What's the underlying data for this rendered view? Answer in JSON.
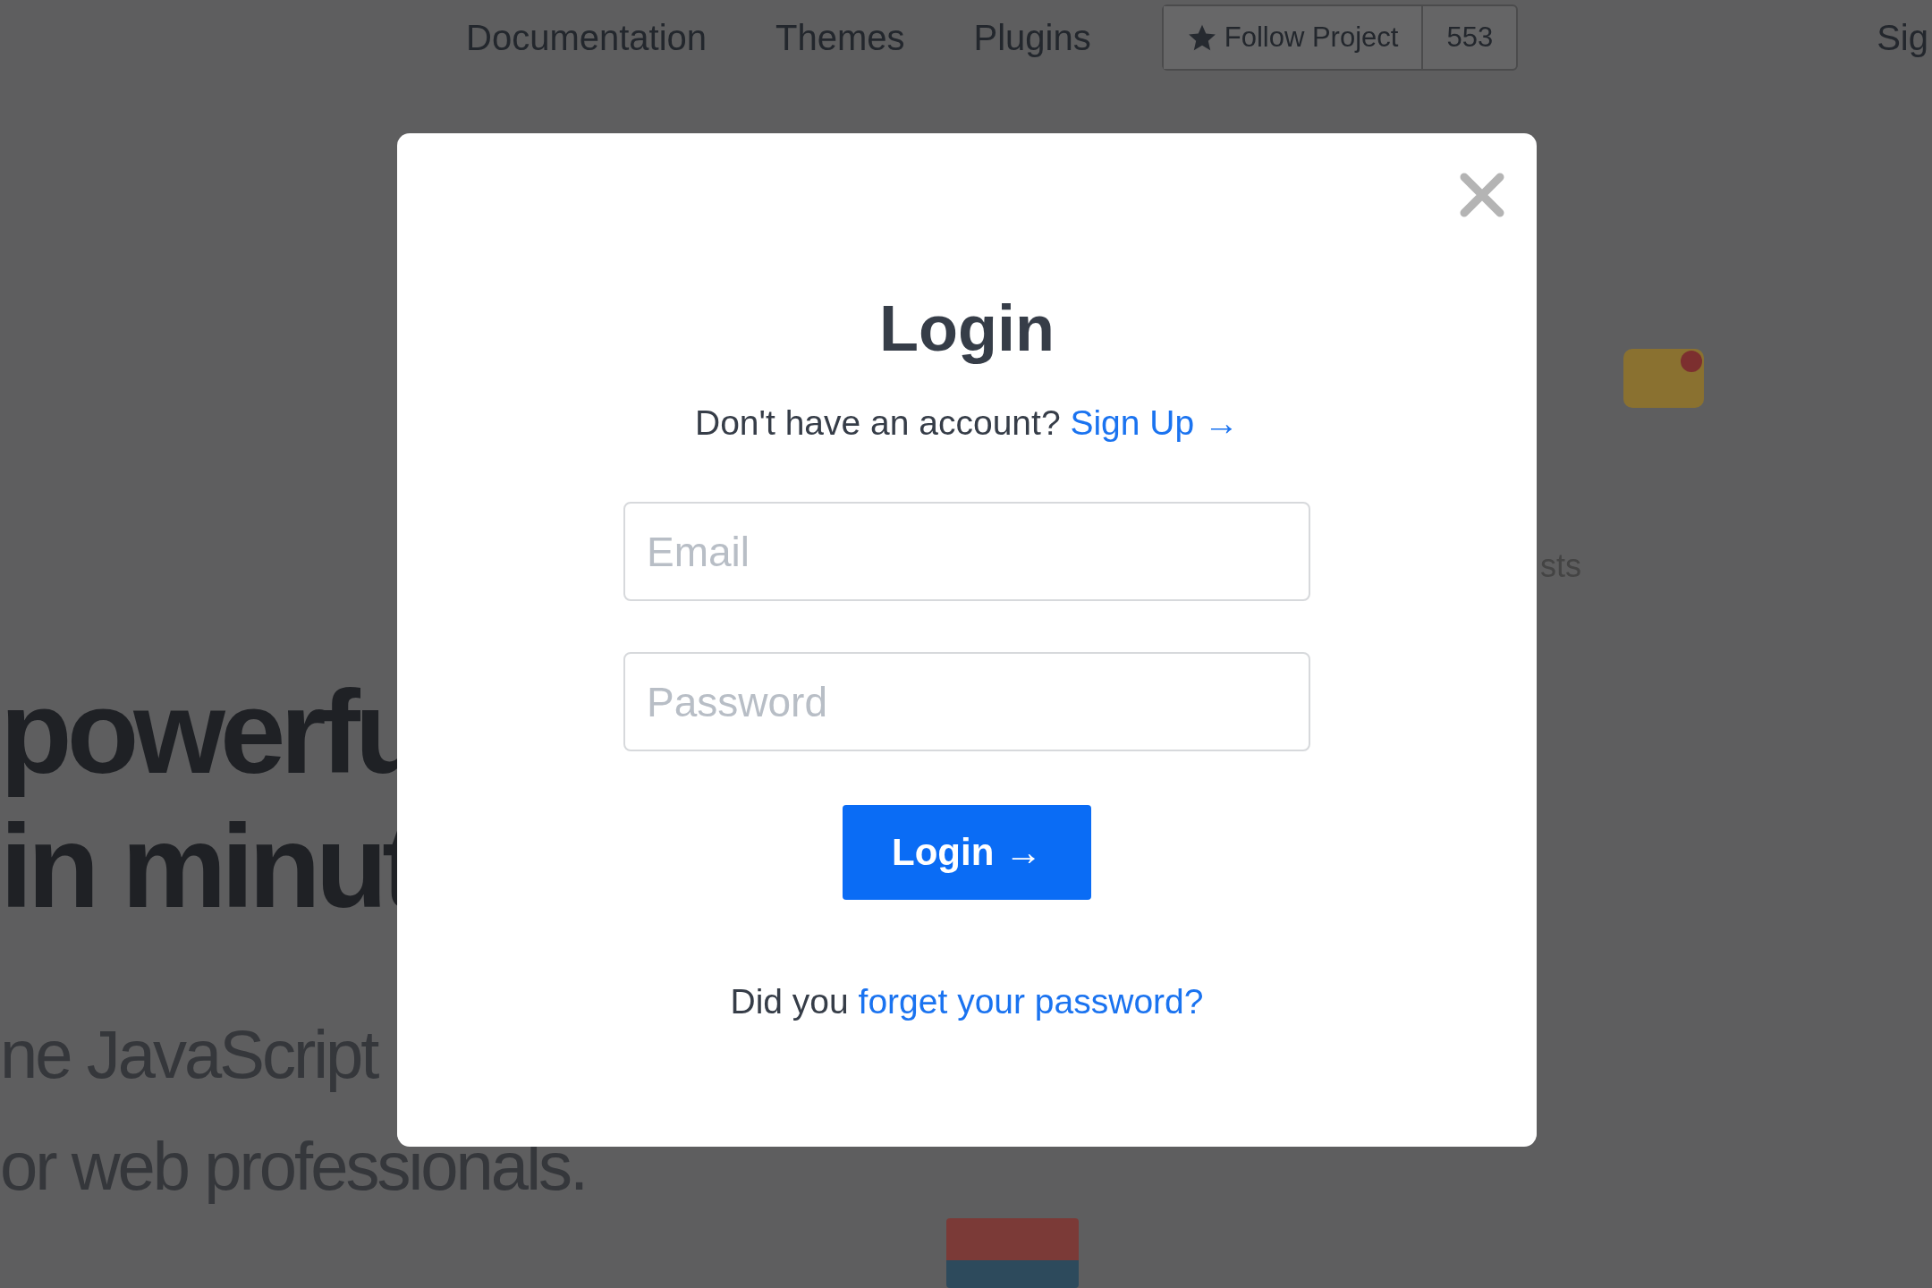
{
  "nav": {
    "links": [
      "Documentation",
      "Themes",
      "Plugins"
    ],
    "follow_button": {
      "label": "Follow Project",
      "count": "553"
    },
    "cut_link": "Sig"
  },
  "hero": {
    "headline_lines": [
      "powerfu",
      "in minut"
    ],
    "subtitle_lines": [
      "ne JavaScript",
      "or web professionals."
    ]
  },
  "side_fragment": "sts",
  "modal": {
    "title": "Login",
    "prompt": "Don't have an account?",
    "signup_link": "Sign Up →",
    "email": {
      "placeholder": "Email"
    },
    "password": {
      "placeholder": "Password"
    },
    "submit": "Login →",
    "forgot_prefix": "Did you",
    "forgot_link": "forget your password?"
  }
}
